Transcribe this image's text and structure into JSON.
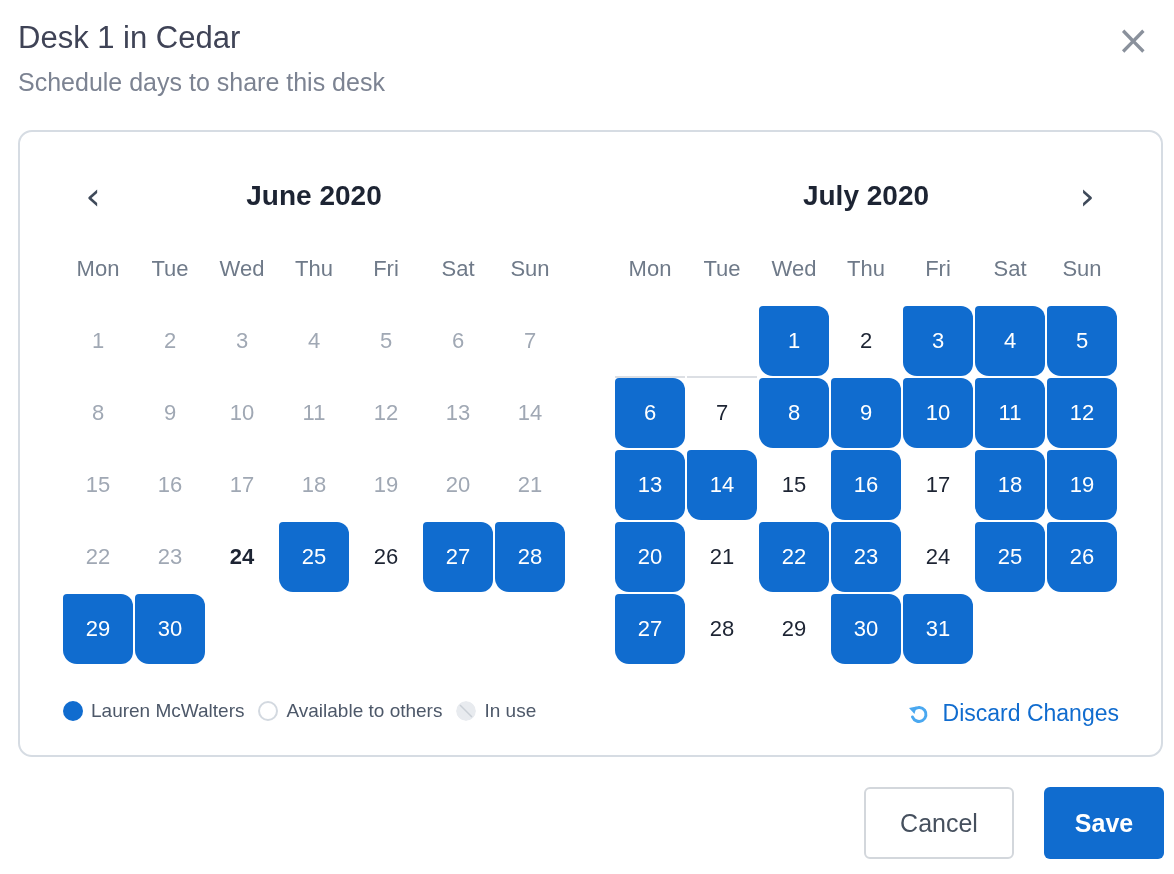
{
  "dialog": {
    "title": "Desk 1 in Cedar",
    "subtitle": "Schedule days to share this desk",
    "close": "×"
  },
  "months": [
    {
      "title": "June 2020",
      "nav": {
        "kind": "prev",
        "symbol": "‹"
      },
      "weekdays": [
        "Mon",
        "Tue",
        "Wed",
        "Thu",
        "Fri",
        "Sat",
        "Sun"
      ],
      "weeks": [
        {
          "days": [
            {
              "kind": "past",
              "label": "1",
              "selected": false
            },
            {
              "kind": "past",
              "label": "2",
              "selected": false
            },
            {
              "kind": "past",
              "label": "3",
              "selected": false
            },
            {
              "kind": "past",
              "label": "4",
              "selected": false
            },
            {
              "kind": "past",
              "label": "5",
              "selected": false
            },
            {
              "kind": "past",
              "label": "6",
              "selected": false
            },
            {
              "kind": "past",
              "label": "7",
              "selected": false
            }
          ]
        },
        {
          "days": [
            {
              "kind": "past",
              "label": "8",
              "selected": false
            },
            {
              "kind": "past",
              "label": "9",
              "selected": false
            },
            {
              "kind": "past",
              "label": "10",
              "selected": false
            },
            {
              "kind": "past",
              "label": "11",
              "selected": false
            },
            {
              "kind": "past",
              "label": "12",
              "selected": false
            },
            {
              "kind": "past",
              "label": "13",
              "selected": false
            },
            {
              "kind": "past",
              "label": "14",
              "selected": false
            }
          ]
        },
        {
          "days": [
            {
              "kind": "past",
              "label": "15",
              "selected": false
            },
            {
              "kind": "past",
              "label": "16",
              "selected": false
            },
            {
              "kind": "past",
              "label": "17",
              "selected": false
            },
            {
              "kind": "past",
              "label": "18",
              "selected": false
            },
            {
              "kind": "past",
              "label": "19",
              "selected": false
            },
            {
              "kind": "past",
              "label": "20",
              "selected": false
            },
            {
              "kind": "past",
              "label": "21",
              "selected": false
            }
          ]
        },
        {
          "days": [
            {
              "kind": "past",
              "label": "22",
              "selected": false
            },
            {
              "kind": "past",
              "label": "23",
              "selected": false
            },
            {
              "kind": "today",
              "label": "24",
              "selected": false
            },
            {
              "kind": "day",
              "label": "25",
              "selected": true
            },
            {
              "kind": "day",
              "label": "26",
              "selected": false
            },
            {
              "kind": "day",
              "label": "27",
              "selected": true
            },
            {
              "kind": "day",
              "label": "28",
              "selected": true
            }
          ]
        },
        {
          "days": [
            {
              "kind": "day",
              "label": "29",
              "selected": true
            },
            {
              "kind": "day",
              "label": "30",
              "selected": true
            }
          ]
        }
      ]
    },
    {
      "title": "July 2020",
      "nav": {
        "kind": "next",
        "symbol": "›"
      },
      "weekdays": [
        "Mon",
        "Tue",
        "Wed",
        "Thu",
        "Fri",
        "Sat",
        "Sun"
      ],
      "weeks": [
        {
          "days": [
            {
              "kind": "blank"
            },
            {
              "kind": "blank"
            },
            {
              "kind": "day",
              "label": "1",
              "selected": true
            },
            {
              "kind": "day",
              "label": "2",
              "selected": false
            },
            {
              "kind": "day",
              "label": "3",
              "selected": true
            },
            {
              "kind": "day",
              "label": "4",
              "selected": true
            },
            {
              "kind": "day",
              "label": "5",
              "selected": true
            }
          ]
        },
        {
          "days": [
            {
              "kind": "day",
              "label": "6",
              "selected": true
            },
            {
              "kind": "day",
              "label": "7",
              "selected": false
            },
            {
              "kind": "day",
              "label": "8",
              "selected": true
            },
            {
              "kind": "day",
              "label": "9",
              "selected": true
            },
            {
              "kind": "day",
              "label": "10",
              "selected": true
            },
            {
              "kind": "day",
              "label": "11",
              "selected": true
            },
            {
              "kind": "day",
              "label": "12",
              "selected": true
            }
          ]
        },
        {
          "days": [
            {
              "kind": "day",
              "label": "13",
              "selected": true
            },
            {
              "kind": "day",
              "label": "14",
              "selected": true
            },
            {
              "kind": "day",
              "label": "15",
              "selected": false
            },
            {
              "kind": "day",
              "label": "16",
              "selected": true
            },
            {
              "kind": "day",
              "label": "17",
              "selected": false
            },
            {
              "kind": "day",
              "label": "18",
              "selected": true
            },
            {
              "kind": "day",
              "label": "19",
              "selected": true
            }
          ]
        },
        {
          "days": [
            {
              "kind": "day",
              "label": "20",
              "selected": true
            },
            {
              "kind": "day",
              "label": "21",
              "selected": false
            },
            {
              "kind": "day",
              "label": "22",
              "selected": true
            },
            {
              "kind": "day",
              "label": "23",
              "selected": true
            },
            {
              "kind": "day",
              "label": "24",
              "selected": false
            },
            {
              "kind": "day",
              "label": "25",
              "selected": true
            },
            {
              "kind": "day",
              "label": "26",
              "selected": true
            }
          ]
        },
        {
          "days": [
            {
              "kind": "day",
              "label": "27",
              "selected": true
            },
            {
              "kind": "day",
              "label": "28",
              "selected": false
            },
            {
              "kind": "day",
              "label": "29",
              "selected": false
            },
            {
              "kind": "day",
              "label": "30",
              "selected": true
            },
            {
              "kind": "day",
              "label": "31",
              "selected": true
            }
          ]
        }
      ]
    }
  ],
  "legend": [
    {
      "kind": "mine",
      "label": "Lauren McWalters"
    },
    {
      "kind": "available",
      "label": "Available to others"
    },
    {
      "kind": "in_use",
      "label": "In use"
    }
  ],
  "discard": "Discard Changes",
  "buttons": [
    {
      "kind": "secondary",
      "label": "Cancel"
    },
    {
      "kind": "primary",
      "label": "Save"
    }
  ]
}
